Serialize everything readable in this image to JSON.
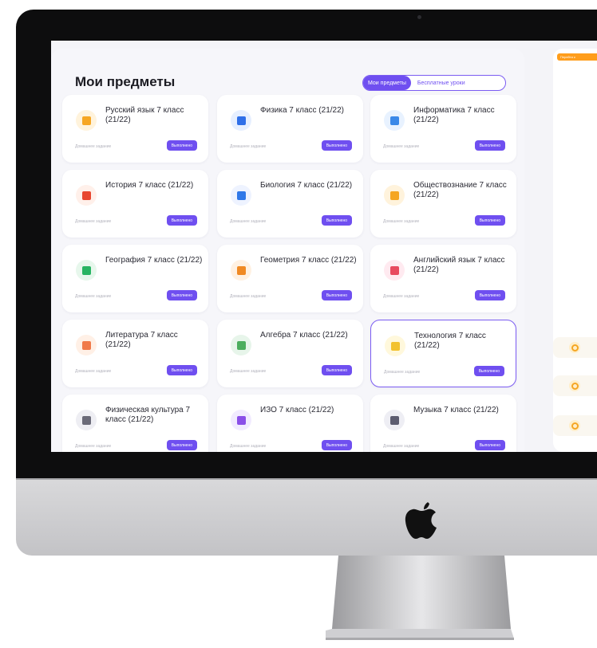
{
  "panel": {
    "title": "Мои предметы",
    "tab_active": "Мои предметы",
    "tab_inactive": "Бесплатные уроки"
  },
  "side": {
    "cta": "Перейти к"
  },
  "card_labels": {
    "homework": "Домашнее задание",
    "status": "Выполнено"
  },
  "subjects": [
    {
      "name": "Русский язык 7 класс (21/22)",
      "icon": "book-icon",
      "color": "#f6a623",
      "bg": "#fff3dc"
    },
    {
      "name": "Физика 7 класс (21/22)",
      "icon": "atom-icon",
      "color": "#2f6fe8",
      "bg": "#e6efff"
    },
    {
      "name": "Информатика 7 класс (21/22)",
      "icon": "monitor-icon",
      "color": "#3a88e8",
      "bg": "#e8f2ff"
    },
    {
      "name": "История 7 класс (21/22)",
      "icon": "history-icon",
      "color": "#e8462f",
      "bg": "#fff0ea"
    },
    {
      "name": "Биология 7 класс (21/22)",
      "icon": "leaf-icon",
      "color": "#2f78e8",
      "bg": "#eef3ff"
    },
    {
      "name": "Обществознание 7 класс (21/22)",
      "icon": "search-icon",
      "color": "#f5a623",
      "bg": "#fff3dc"
    },
    {
      "name": "География 7 класс (21/22)",
      "icon": "globe-icon",
      "color": "#27b462",
      "bg": "#e7f7ec"
    },
    {
      "name": "Геометрия 7 класс (21/22)",
      "icon": "ruler-icon",
      "color": "#f08a24",
      "bg": "#fff1e2"
    },
    {
      "name": "Английский язык 7 класс (21/22)",
      "icon": "flag-icon",
      "color": "#e84a5f",
      "bg": "#ffeaf0"
    },
    {
      "name": "Литература 7 класс (21/22)",
      "icon": "open-book-icon",
      "color": "#f07a4a",
      "bg": "#fff0e6"
    },
    {
      "name": "Алгебра 7 класс (21/22)",
      "icon": "calculator-icon",
      "color": "#4cae5e",
      "bg": "#e7f5ea"
    },
    {
      "name": "Технология 7 класс (21/22)",
      "icon": "lightbulb-icon",
      "color": "#f2c230",
      "bg": "#fff8dc"
    },
    {
      "name": "Физическая культура 7 класс (21/22)",
      "icon": "ball-icon",
      "color": "#6a6a78",
      "bg": "#eeeef3"
    },
    {
      "name": "ИЗО 7 класс (21/22)",
      "icon": "brush-icon",
      "color": "#8a4fe8",
      "bg": "#f1ebff"
    },
    {
      "name": "Музыка 7 класс (21/22)",
      "icon": "music-icon",
      "color": "#5c5c70",
      "bg": "#eeeef4"
    }
  ],
  "active_subject": "Технология 7 класс (21/22)"
}
